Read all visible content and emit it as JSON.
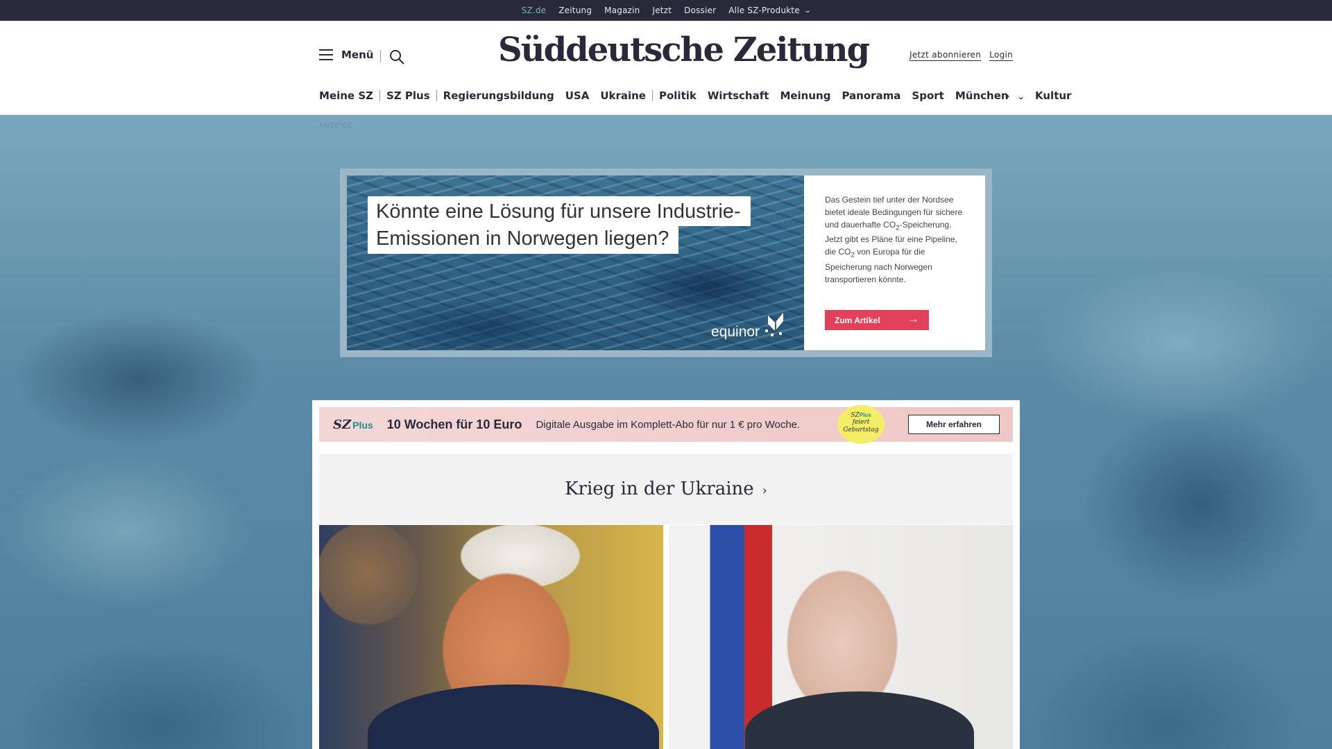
{
  "topbar": {
    "items": [
      "SZ.de",
      "Zeitung",
      "Magazin",
      "Jetzt",
      "Dossier",
      "Alle SZ-Produkte"
    ]
  },
  "header": {
    "menu_label": "Menü",
    "logo_text": "Süddeutsche Zeitung",
    "subscribe_label": "Jetzt abonnieren",
    "login_label": "Login"
  },
  "nav": {
    "items": [
      "Meine SZ",
      "SZ Plus",
      "Regierungsbildung",
      "USA",
      "Ukraine",
      "Politik",
      "Wirtschaft",
      "Meinung",
      "Panorama",
      "Sport",
      "München",
      "Kultur"
    ]
  },
  "ad": {
    "label": "ANZEIGE",
    "headline_line1": "Könnte eine Lösung für unsere Industrie-",
    "headline_line2": "Emissionen in Norwegen liegen?",
    "brand": "equinor",
    "body_part1": "Das Gestein tief unter der Nordsee bietet ideale Bedingungen für sichere und dauerhafte CO",
    "body_sub1": "2",
    "body_part2": "-Speicherung. Jetzt gibt es Pläne für eine Pipeline, die CO",
    "body_sub2": "2",
    "body_part3": " von Europa für die Speicherung nach Norwegen transportieren könnte.",
    "cta_label": "Zum Artikel"
  },
  "promo": {
    "logo_sz": "SZ",
    "logo_plus": "Plus",
    "title": "10 Wochen für 10 Euro",
    "subtitle": "Digitale Ausgabe im Komplett-Abo für nur 1 € pro Woche.",
    "badge_sz": "SZ",
    "badge_plus": "Plus",
    "badge_line1": "feiert",
    "badge_line2": "Geburtstag",
    "button_label": "Mehr erfahren"
  },
  "section": {
    "title": "Krieg in der Ukraine"
  },
  "colors": {
    "topbar_bg": "#29293a",
    "active_link": "#6fb8c4",
    "cta_red": "#e3405a",
    "promo_pink": "#f3d7d7",
    "badge_yellow": "#f4ee67",
    "plus_teal": "#1f8f8a"
  }
}
